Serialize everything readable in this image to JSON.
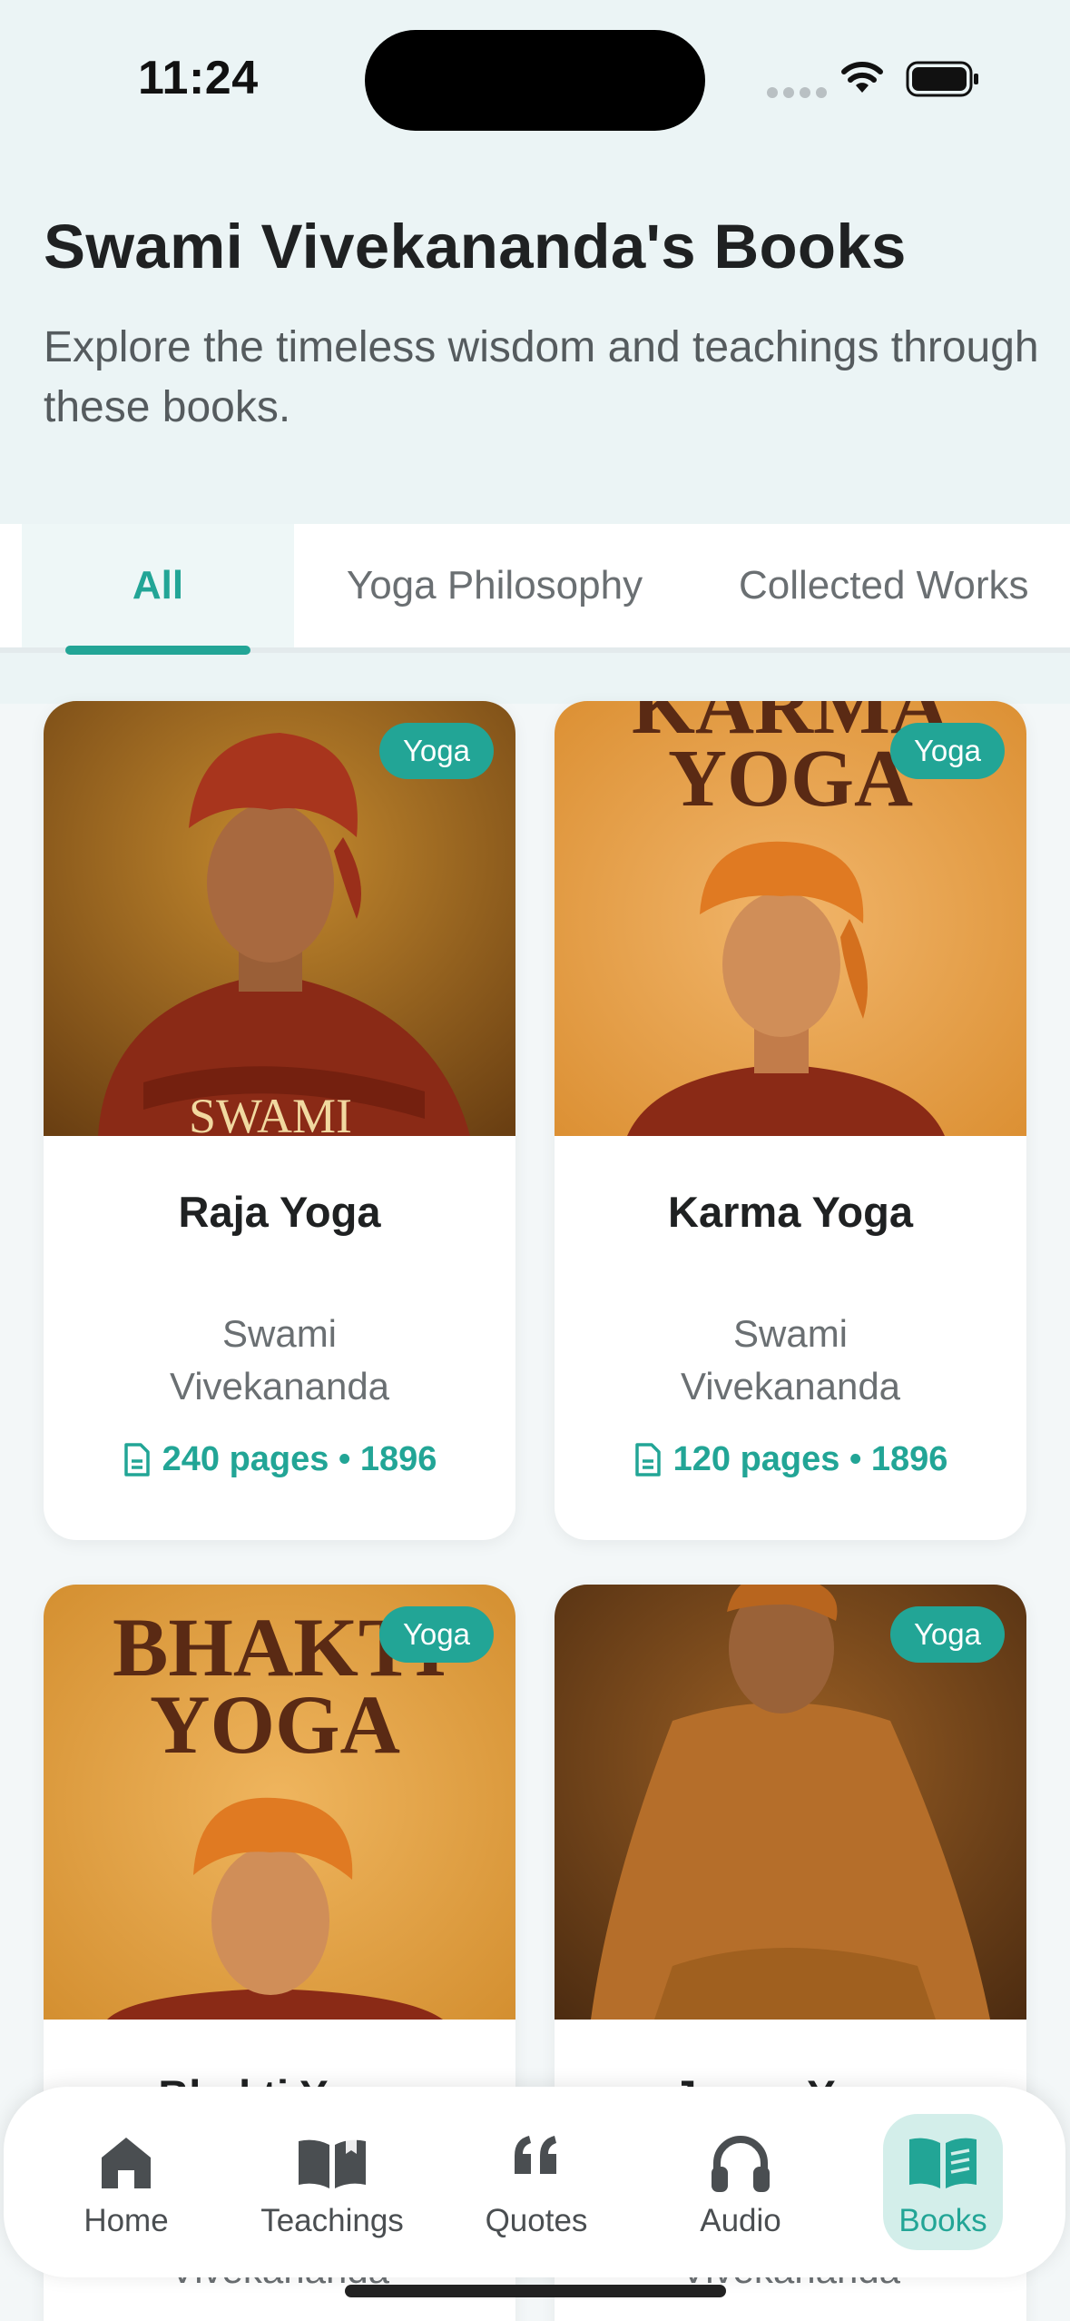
{
  "status": {
    "time": "11:24"
  },
  "header": {
    "title": "Swami Vivekananda's Books",
    "subtitle": "Explore the timeless wisdom and teachings through these books."
  },
  "tabs": [
    {
      "label": "All",
      "active": true
    },
    {
      "label": "Yoga Philosophy",
      "active": false
    },
    {
      "label": "Collected Works",
      "active": false
    }
  ],
  "books": [
    {
      "title": "Raja Yoga",
      "author": "Swami Vivekananda",
      "pages": "240 pages",
      "year": "1896",
      "meta": "240 pages • 1896",
      "badge": "Yoga",
      "cover_text": "SWAMI"
    },
    {
      "title": "Karma Yoga",
      "author": "Swami Vivekananda",
      "pages": "120 pages",
      "year": "1896",
      "meta": "120 pages • 1896",
      "badge": "Yoga",
      "cover_text_1": "KARMA",
      "cover_text_2": "YOGA"
    },
    {
      "title": "Bhakti Yoga",
      "author": "Swami Vivekananda",
      "badge": "Yoga",
      "cover_text_1": "BHAKTI",
      "cover_text_2": "YOGA"
    },
    {
      "title": "Jnana Yoga",
      "author": "Swami Vivekananda",
      "badge": "Yoga"
    }
  ],
  "nav": [
    {
      "label": "Home",
      "icon": "home-icon",
      "active": false
    },
    {
      "label": "Teachings",
      "icon": "book-open-icon",
      "active": false
    },
    {
      "label": "Quotes",
      "icon": "quote-icon",
      "active": false
    },
    {
      "label": "Audio",
      "icon": "headphones-icon",
      "active": false
    },
    {
      "label": "Books",
      "icon": "books-icon",
      "active": true
    }
  ],
  "colors": {
    "accent": "#22a596",
    "header_bg": "#ebf4f5",
    "text": "#1f2122"
  }
}
